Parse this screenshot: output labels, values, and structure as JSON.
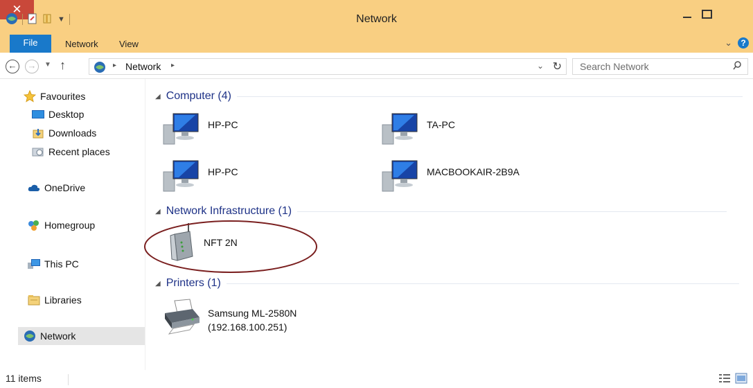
{
  "window": {
    "title": "Network"
  },
  "ribbon": {
    "tabs": [
      "File",
      "Network",
      "View"
    ]
  },
  "address": {
    "path": "Network",
    "search_placeholder": "Search Network"
  },
  "sidebar": {
    "favourites": "Favourites",
    "fav_items": [
      "Desktop",
      "Downloads",
      "Recent places"
    ],
    "onedrive": "OneDrive",
    "homegroup": "Homegroup",
    "thispc": "This PC",
    "libraries": "Libraries",
    "network": "Network"
  },
  "groups": [
    {
      "header": "Computer (4)",
      "items": [
        "HP-PC",
        "TA-PC",
        "HP-PC",
        "MACBOOKAIR-2B9A"
      ]
    },
    {
      "header": "Network Infrastructure (1)",
      "items": [
        "NFT 2N"
      ]
    },
    {
      "header": "Printers (1)",
      "items": [
        "Samsung ML-2580N",
        "(192.168.100.251)"
      ]
    }
  ],
  "status": {
    "count": "11 items"
  },
  "colors": {
    "titlebar": "#f9cf82",
    "accent": "#1979ca",
    "group_header": "#1e3287",
    "close": "#c9483a",
    "ellipse": "#7a1f1f"
  }
}
